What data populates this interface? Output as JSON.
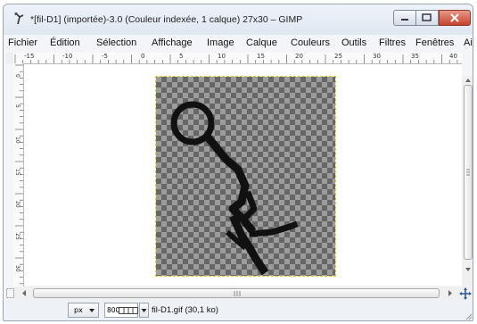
{
  "window": {
    "title": "*[fil-D1] (importée)-3.0 (Couleur indexée, 1 calque) 27x30 – GIMP"
  },
  "menu": [
    {
      "label": "Fichier",
      "name": "menu-fichier"
    },
    {
      "label": "Édition",
      "name": "menu-edition"
    },
    {
      "label": "Sélection",
      "name": "menu-selection"
    },
    {
      "label": "Affichage",
      "name": "menu-affichage"
    },
    {
      "label": "Image",
      "name": "menu-image"
    },
    {
      "label": "Calque",
      "name": "menu-calque"
    },
    {
      "label": "Couleurs",
      "name": "menu-couleurs"
    },
    {
      "label": "Outils",
      "name": "menu-outils"
    },
    {
      "label": "Filtres",
      "name": "menu-filtres"
    },
    {
      "label": "Fenêtres",
      "name": "menu-fenetres"
    },
    {
      "label": "Ai",
      "name": "menu-aide"
    }
  ],
  "ruler": {
    "top_labels": [
      "-15",
      "-10",
      "-5",
      "0",
      "5",
      "10",
      "15",
      "20",
      "25",
      "30",
      "35",
      "40"
    ],
    "left_labels": [
      "0",
      "5",
      "10",
      "15",
      "20",
      "25",
      "30"
    ]
  },
  "statusbar": {
    "unit": "px",
    "zoom": "800",
    "file_info": "fil-D1.gif (30,1 ko)"
  },
  "icons": {
    "app": "gimp-icon",
    "minimize": "minimize-icon",
    "maximize": "maximize-icon",
    "close": "close-icon",
    "scroll_left": "arrow-left-icon",
    "scroll_right": "arrow-right-icon",
    "scroll_up": "arrow-up-icon",
    "scroll_down": "arrow-down-icon",
    "navigate": "navigate-icon"
  },
  "colors": {
    "close_button": "#c6432d",
    "selection_border": "#e0d020",
    "checker_dark": "#666666",
    "checker_light": "#9c9c9c",
    "drawing_stroke": "#111111"
  }
}
